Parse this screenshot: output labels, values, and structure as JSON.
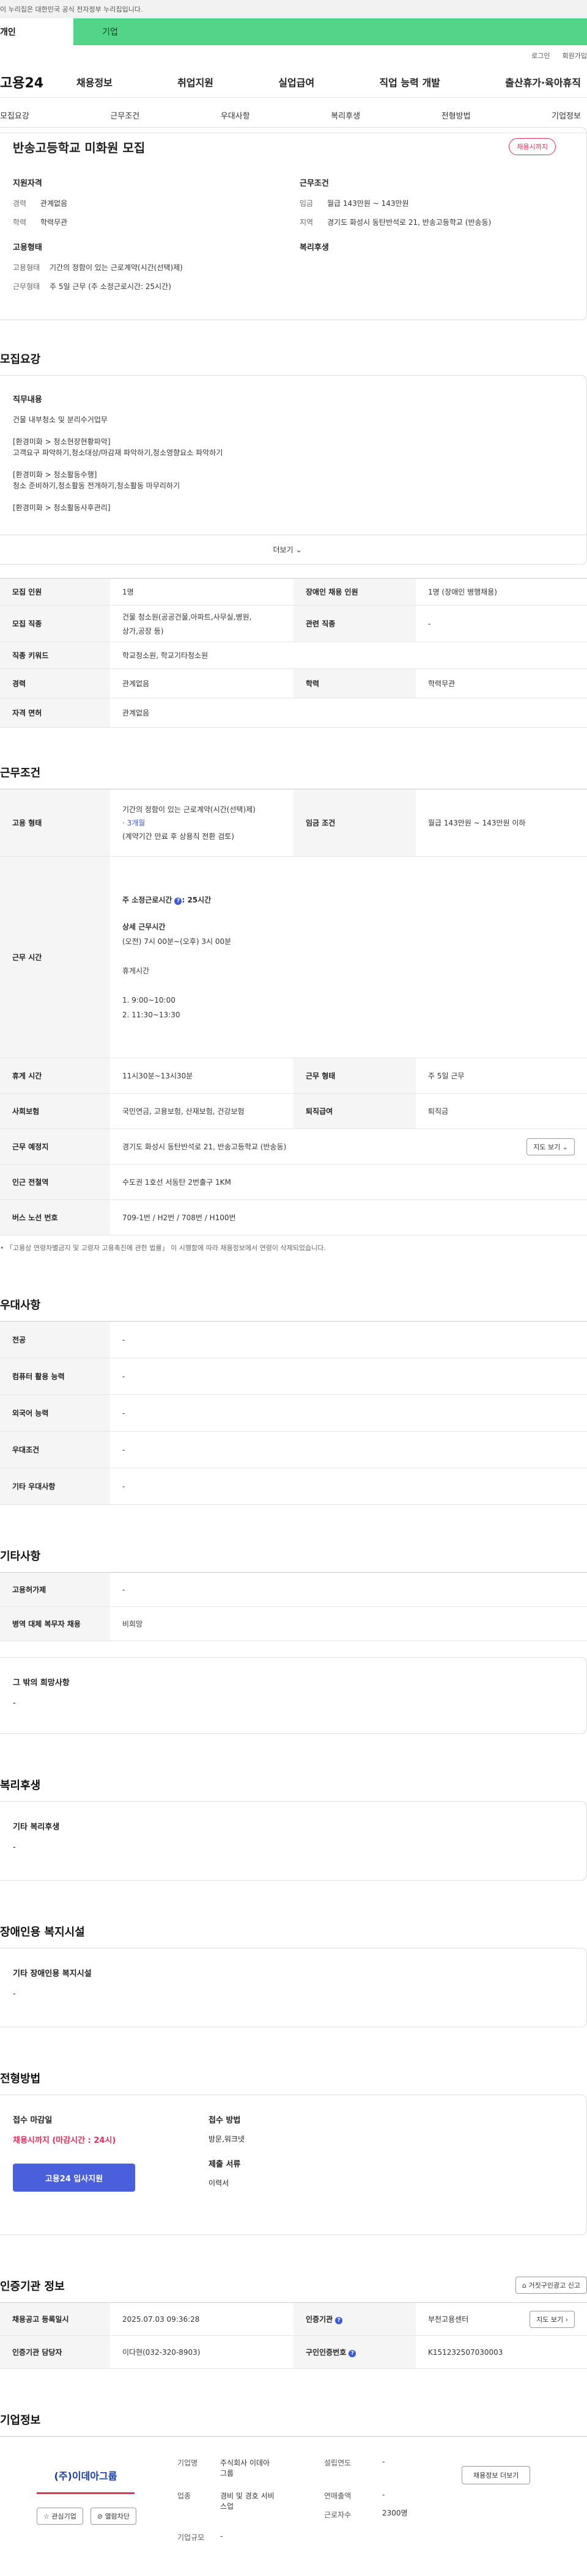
{
  "gov_strip": "이 누리집은 대한민국 공식 전자정부 누리집입니다.",
  "top_tabs": [
    "개인",
    "기업"
  ],
  "util": [
    "로그인",
    "회원가입"
  ],
  "logo": "고용24",
  "gnb": [
    "채용정보",
    "취업지원",
    "실업급여",
    "직업 능력 개발",
    "출산휴가·육아휴직"
  ],
  "subnav": [
    "모집요강",
    "근무조건",
    "우대사항",
    "복리후생",
    "전형방법",
    "기업정보"
  ],
  "header": {
    "title": "반송고등학교 미화원 모집",
    "badge": "채용시까지",
    "qual_title": "지원자격",
    "career_k": "경력",
    "career_v": "관계없음",
    "edu_k": "학력",
    "edu_v": "학력무관",
    "emp_title": "고용형태",
    "emptype_k": "고용형태",
    "emptype_v": "기간의 정함이 있는 근로계약(시간(선택)제)",
    "worktype_k": "근무형태",
    "worktype_v": "주 5일 근무 (주 소정근로시간: 25시간)",
    "cond_title": "근무조건",
    "wage_k": "임금",
    "wage_v": "월급 143만원 ~ 143만원",
    "area_k": "지역",
    "area_v": "경기도 화성시 동탄반석로 21, 반송고등학교 (반송동)",
    "welfare_title": "복리후생"
  },
  "recruit": {
    "section": "모집요강",
    "duty_title": "직무내용",
    "duty_text": "건물 내부청소 및 분리수거업무\n\n[환경미화 > 청소현장현황파악]\n고객요구 파악하기,청소대상/마감재 파악하기,청소영향요소 파악하기\n\n[환경미화 > 청소활동수행]\n청소 준비하기,청소활동 전개하기,청소활동 마무리하기\n\n[환경미화 > 청소활동사후관리]",
    "more": "더보기",
    "rows": {
      "count_k": "모집 인원",
      "count_v": "1명",
      "dis_k": "장애인 채용 인원",
      "dis_v": "1명 (장애인 병행채용)",
      "job_k": "모집 직종",
      "job_v1": "건물 청소원(공공건물,아파트,사무실,병원,",
      "job_v2": "상가,공장 등)",
      "rel_k": "관련 직종",
      "rel_v": "-",
      "kw_k": "직종 키워드",
      "kw_v": "학교청소원, 학교기타청소원",
      "car_k": "경력",
      "car_v": "관계없음",
      "edu_k": "학력",
      "edu_v": "학력무관",
      "lic_k": "자격 면허",
      "lic_v": "관계없음"
    }
  },
  "work": {
    "section": "근무조건",
    "emp_k": "고용 형태",
    "emp_v1": "기간의 정함이 있는 근로계약(시간(선택)제)",
    "emp_v2": "· 3개월",
    "emp_v3": "(계약기간 만료 후 상용직 전환 검토)",
    "wage_k": "임금 조건",
    "wage_v": "월급 143만원 ~ 143만원 이하",
    "time_k": "근무 시간",
    "time_head": "주 소정근로시간",
    "time_head_v": ": 25시간",
    "time_detail_title": "상세 근무시간",
    "time_detail": "(오전) 7시 00분~(오후) 3시 00분",
    "rest_title": "휴게시간",
    "rest1": "1. 9:00~10:00",
    "rest2": "2. 11:30~13:30",
    "break_k": "휴게 시간",
    "break_v": "11시30분~13시30분",
    "wtype_k": "근무 형태",
    "wtype_v": "주 5일 근무",
    "ins_k": "사회보험",
    "ins_v": "국민연금, 고용보험, 산재보험, 건강보험",
    "ret_k": "퇴직급여",
    "ret_v": "퇴직금",
    "place_k": "근무 예정지",
    "place_v": "경기도 화성시 동탄반석로 21, 반송고등학교 (반송동)",
    "map_btn": "지도 보기",
    "subway_k": "인근 전철역",
    "subway_v": "수도권 1호선 서동탄 2번출구 1KM",
    "bus_k": "버스 노선 번호",
    "bus_v": "709-1번 / H2번 / 708번 / H100번",
    "note": "「고용상 연령차별금지 및 고령자 고용촉진에 관한 법률」 이 시행함에 따라 채용정보에서 연령이 삭제되었습니다."
  },
  "pref": {
    "section": "우대사항",
    "rows": [
      {
        "k": "전공",
        "v": "-"
      },
      {
        "k": "컴퓨터 활용 능력",
        "v": "-"
      },
      {
        "k": "외국어 능력",
        "v": "-"
      },
      {
        "k": "우대조건",
        "v": "-"
      },
      {
        "k": "기타 우대사항",
        "v": "-"
      }
    ]
  },
  "etc": {
    "section": "기타사항",
    "r1k": "고용허가제",
    "r1v": "-",
    "r2k": "병역 대체 복무자 채용",
    "r2v": "비희망",
    "box_title": "그 밖의 희망사항",
    "box_v": "-"
  },
  "welfare": {
    "section": "복리후생",
    "box_title": "기타 복리후생",
    "box_v": "-"
  },
  "disability": {
    "section": "장애인용 복지시설",
    "box_title": "기타 장애인용 복지시설",
    "box_v": "-"
  },
  "screening": {
    "section": "전형방법",
    "deadline_title": "접수 마감일",
    "deadline_v": "채용시까지 (마감시간 : 24시)",
    "apply_btn": "고용24 입사지원",
    "method_title": "접수 방법",
    "method_v": "방문,워크넷",
    "docs_title": "제출 서류",
    "docs_v": "이력서"
  },
  "cert": {
    "section": "인증기관 정보",
    "report_btn": "거짓구인광고 신고",
    "reg_k": "채용공고 등록일시",
    "reg_v": "2025.07.03 09:36:28",
    "org_k": "인증기관",
    "org_v": "부천고용센터",
    "map_btn": "지도 보기",
    "mgr_k": "인증기관 담당자",
    "mgr_v": "이다현(032-320-8903)",
    "num_k": "구인인증번호",
    "num_v": "K151232507030003"
  },
  "company": {
    "section": "기업정보",
    "logo_text": "(주)이데아그룹",
    "fav_btn": "관심기업",
    "block_btn": "열람차단",
    "name_k": "기업명",
    "name_v1": "주식회사 이데아",
    "name_v2": "그룹",
    "ind_k": "업종",
    "ind_v1": "경비 및 경호 서비",
    "ind_v2": "스업",
    "scale_k": "기업규모",
    "scale_v": "-",
    "est_k": "설립연도",
    "est_v": "-",
    "sales_k": "연매출액",
    "sales_v": "-",
    "emp_k": "근로자수",
    "emp_v": "2300명",
    "info_btn": "채용정보 더보기"
  }
}
